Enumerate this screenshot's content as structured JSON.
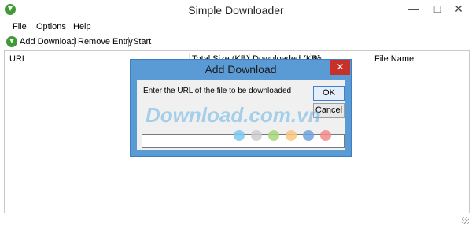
{
  "window": {
    "title": "Simple Downloader",
    "controls": {
      "minimize": "—",
      "maximize": "□",
      "close": "✕"
    }
  },
  "menu": [
    "File",
    "Options",
    "Help"
  ],
  "toolbar": {
    "add_download": "Add Download",
    "remove_entry": "Remove Entry",
    "start": "Start"
  },
  "list": {
    "columns": [
      "URL",
      "Total Size (KB)",
      "Downloaded (KB)",
      "%",
      "File Name"
    ]
  },
  "dialog": {
    "title": "Add Download",
    "close": "✕",
    "prompt": "Enter the URL of the file to be downloaded",
    "ok_label": "OK",
    "cancel_label": "Cancel",
    "url_value": ""
  },
  "watermark": {
    "text": "Download.com.vn",
    "dots": [
      "#7cc8ee",
      "#cccccc",
      "#a6d77a",
      "#f9c77e",
      "#6ea3dc",
      "#f28b8b"
    ]
  }
}
